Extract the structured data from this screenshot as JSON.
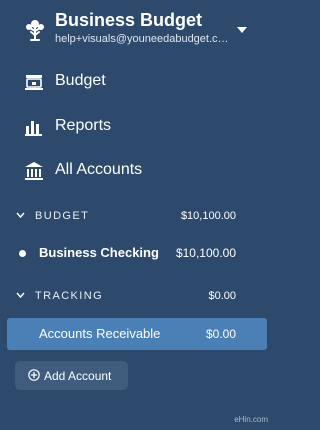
{
  "header": {
    "budget_name": "Business Budget",
    "email": "help+visuals@youneedabudget.com",
    "logo_icon": "tree-icon",
    "menu_icon": "caret-down-icon"
  },
  "nav": {
    "budget_label": "Budget",
    "reports_label": "Reports",
    "all_accounts_label": "All Accounts"
  },
  "groups": {
    "budget": {
      "title": "BUDGET",
      "total": "$10,100.00",
      "accounts": [
        {
          "name": "Business Checking",
          "balance": "$10,100.00"
        }
      ]
    },
    "tracking": {
      "title": "TRACKING",
      "total": "$0.00",
      "accounts": [
        {
          "name": "Accounts Receivable",
          "balance": "$0.00"
        }
      ]
    }
  },
  "add_account_label": "Add Account",
  "watermark": "eHin.com",
  "colors": {
    "sidebar_bg": "#2d4a6c",
    "selected_bg": "#4a80b6",
    "button_bg": "#3f5c7d"
  }
}
